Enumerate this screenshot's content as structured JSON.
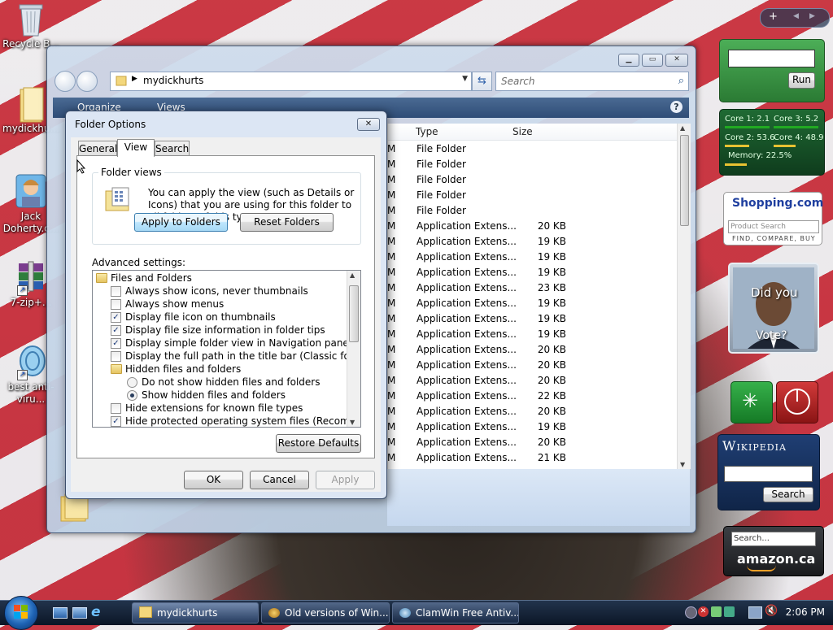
{
  "desktop": {
    "icons": [
      {
        "label": "Recycle B...",
        "icon": "recycle-bin-icon"
      },
      {
        "label": "mydickhu...",
        "icon": "folder-icon"
      },
      {
        "label": "Jack Doherty.c...",
        "icon": "contact-icon"
      },
      {
        "label": "7-zip+...",
        "icon": "archive-icon"
      },
      {
        "label": "best anti-viru...",
        "icon": "antivirus-icon"
      }
    ]
  },
  "explorer": {
    "address": "mydickhurts",
    "search_placeholder": "Search",
    "toolbar": {
      "organize": "Organize",
      "views": "Views"
    },
    "columns": {
      "type": "Type",
      "size": "Size"
    },
    "rows": [
      {
        "m": "M",
        "type": "File Folder",
        "size": ""
      },
      {
        "m": "M",
        "type": "File Folder",
        "size": ""
      },
      {
        "m": "M",
        "type": "File Folder",
        "size": ""
      },
      {
        "m": "M",
        "type": "File Folder",
        "size": ""
      },
      {
        "m": "M",
        "type": "File Folder",
        "size": ""
      },
      {
        "m": "M",
        "type": "Application Extens...",
        "size": "20 KB"
      },
      {
        "m": "M",
        "type": "Application Extens...",
        "size": "19 KB"
      },
      {
        "m": "M",
        "type": "Application Extens...",
        "size": "19 KB"
      },
      {
        "m": "M",
        "type": "Application Extens...",
        "size": "19 KB"
      },
      {
        "m": "M",
        "type": "Application Extens...",
        "size": "23 KB"
      },
      {
        "m": "M",
        "type": "Application Extens...",
        "size": "19 KB"
      },
      {
        "m": "M",
        "type": "Application Extens...",
        "size": "19 KB"
      },
      {
        "m": "M",
        "type": "Application Extens...",
        "size": "19 KB"
      },
      {
        "m": "M",
        "type": "Application Extens...",
        "size": "20 KB"
      },
      {
        "m": "M",
        "type": "Application Extens...",
        "size": "20 KB"
      },
      {
        "m": "M",
        "type": "Application Extens...",
        "size": "20 KB"
      },
      {
        "m": "M",
        "type": "Application Extens...",
        "size": "22 KB"
      },
      {
        "m": "M",
        "type": "Application Extens...",
        "size": "20 KB"
      },
      {
        "m": "M",
        "type": "Application Extens...",
        "size": "19 KB"
      },
      {
        "m": "M",
        "type": "Application Extens...",
        "size": "20 KB"
      },
      {
        "m": "M",
        "type": "Application Extens...",
        "size": "21 KB"
      }
    ]
  },
  "dialog": {
    "title": "Folder Options",
    "tabs": [
      "General",
      "View",
      "Search"
    ],
    "active_tab": "View",
    "folder_views": {
      "legend": "Folder views",
      "description": "You can apply the view (such as Details or Icons) that you are using for this folder to all folders of this type.",
      "apply_button": "Apply to Folders",
      "reset_button": "Reset Folders"
    },
    "advanced_label": "Advanced settings:",
    "advanced_items": [
      {
        "kind": "folder",
        "label": "Files and Folders",
        "indent": 0
      },
      {
        "kind": "checkbox",
        "label": "Always show icons, never thumbnails",
        "checked": false,
        "indent": 1
      },
      {
        "kind": "checkbox",
        "label": "Always show menus",
        "checked": false,
        "indent": 1
      },
      {
        "kind": "checkbox",
        "label": "Display file icon on thumbnails",
        "checked": true,
        "indent": 1
      },
      {
        "kind": "checkbox",
        "label": "Display file size information in folder tips",
        "checked": true,
        "indent": 1
      },
      {
        "kind": "checkbox",
        "label": "Display simple folder view in Navigation pane",
        "checked": true,
        "indent": 1
      },
      {
        "kind": "checkbox",
        "label": "Display the full path in the title bar (Classic folders only)",
        "checked": false,
        "indent": 1
      },
      {
        "kind": "folder",
        "label": "Hidden files and folders",
        "indent": 1
      },
      {
        "kind": "radio",
        "label": "Do not show hidden files and folders",
        "checked": false,
        "indent": 2
      },
      {
        "kind": "radio",
        "label": "Show hidden files and folders",
        "checked": true,
        "indent": 2
      },
      {
        "kind": "checkbox",
        "label": "Hide extensions for known file types",
        "checked": false,
        "indent": 1
      },
      {
        "kind": "checkbox",
        "label": "Hide protected operating system files (Recommended)",
        "checked": true,
        "indent": 1
      }
    ],
    "restore_button": "Restore Defaults",
    "ok": "OK",
    "cancel": "Cancel",
    "apply": "Apply"
  },
  "taskbar": {
    "items": [
      {
        "label": "mydickhurts",
        "icon": "folder-icon"
      },
      {
        "label": "Old versions of Win...",
        "icon": "browser-icon"
      },
      {
        "label": "ClamWin Free Antiv...",
        "icon": "antivirus-icon"
      }
    ],
    "clock": "2:06 PM"
  },
  "gadgets": {
    "run_button": "Run",
    "cpu": {
      "core1": "Core 1: 2.1",
      "core3": "Core 3: 5.2",
      "core2": "Core 2: 53.6",
      "core4": "Core 4: 48.9",
      "memory": "Memory: 22.5%"
    },
    "shopping": {
      "brand": "Shopping.com",
      "placeholder": "Product Search",
      "tagline": "FIND, COMPARE, BUY"
    },
    "photo_caption_top": "Did you",
    "photo_caption_bottom": "Vote?",
    "wikipedia": {
      "title": "Wikipedia",
      "search_button": "Search"
    },
    "amazon": {
      "placeholder": "Search...",
      "brand": "amazon.ca"
    }
  },
  "colors": {
    "accent": "#2f4d77",
    "taskbar": "#0b1626",
    "window_frame": "#c6d7ec"
  }
}
